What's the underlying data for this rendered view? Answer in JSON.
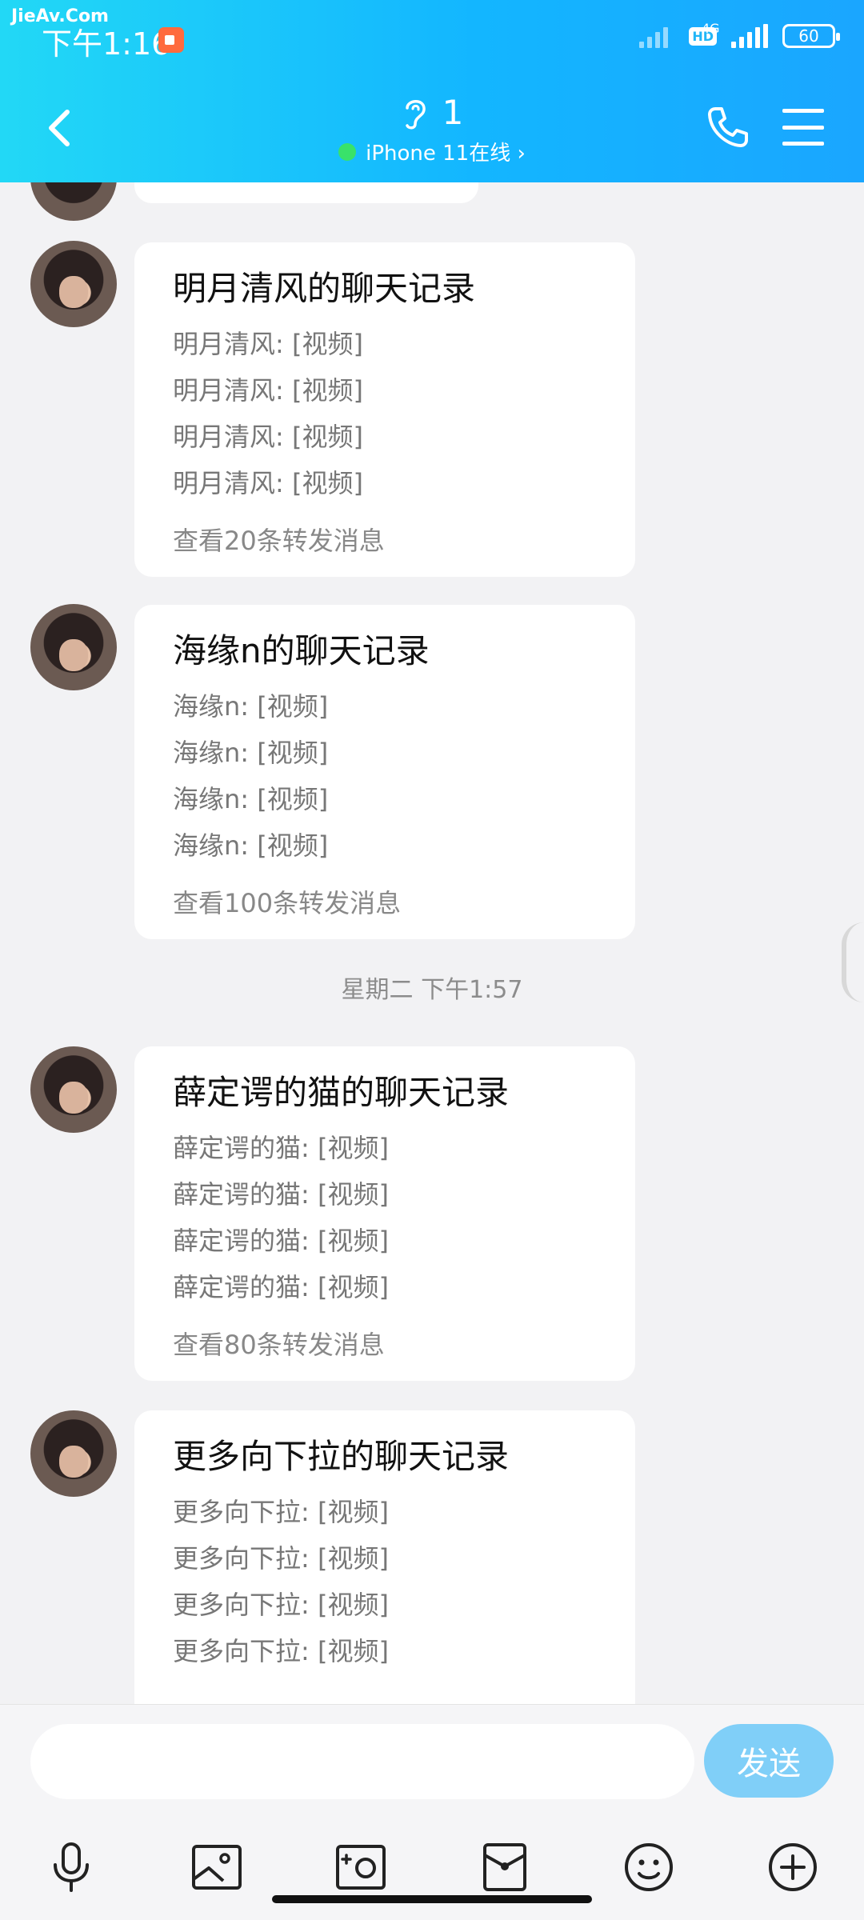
{
  "watermark": "JieAv.Com",
  "status_bar": {
    "time": "下午1:16",
    "hd_badge": "HD",
    "network": "4G",
    "battery": "60"
  },
  "header": {
    "title_number": "1",
    "subtitle": "iPhone 11在线 ›",
    "accent_color": "#13b6ff",
    "online_color": "#39e26a"
  },
  "messages": [
    {
      "title": "明月清风的聊天记录",
      "lines": [
        "明月清风: [视频]",
        "明月清风: [视频]",
        "明月清风: [视频]",
        "明月清风: [视频]"
      ],
      "footer": "查看20条转发消息"
    },
    {
      "title": "海缘n的聊天记录",
      "lines": [
        "海缘n: [视频]",
        "海缘n: [视频]",
        "海缘n: [视频]",
        "海缘n: [视频]"
      ],
      "footer": "查看100条转发消息"
    },
    {
      "title": "薛定谔的猫的聊天记录",
      "lines": [
        "薛定谔的猫: [视频]",
        "薛定谔的猫: [视频]",
        "薛定谔的猫: [视频]",
        "薛定谔的猫: [视频]"
      ],
      "footer": "查看80条转发消息"
    },
    {
      "title": "更多向下拉的聊天记录",
      "lines": [
        "更多向下拉: [视频]",
        "更多向下拉: [视频]",
        "更多向下拉: [视频]",
        "更多向下拉: [视频]"
      ]
    }
  ],
  "timestamp": "星期二 下午1:57",
  "input": {
    "placeholder": "",
    "send_label": "发送"
  },
  "toolbar_icons": [
    "microphone-icon",
    "image-icon",
    "camera-icon",
    "red-packet-icon",
    "emoji-icon",
    "plus-icon"
  ]
}
